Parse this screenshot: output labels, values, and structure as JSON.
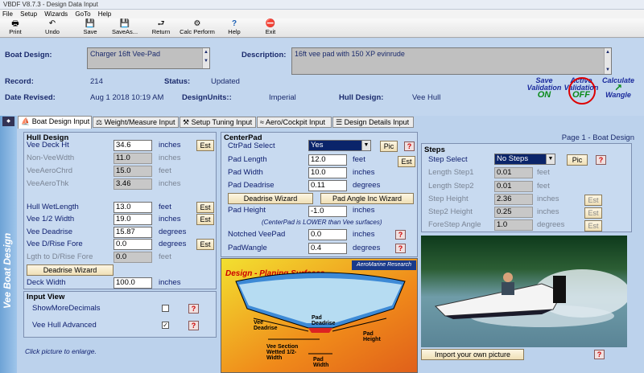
{
  "window_title": "VBDF V8.7.3 - Design Data Input",
  "menu": [
    "File",
    "Setup",
    "Wizards",
    "GoTo",
    "Help"
  ],
  "toolbar": [
    {
      "label": "Print",
      "icon": "🖶"
    },
    {
      "label": "Undo",
      "icon": "↶"
    },
    {
      "label": "Save",
      "icon": "💾"
    },
    {
      "label": "SaveAs...",
      "icon": "💾"
    },
    {
      "label": "Return",
      "icon": "⮐"
    },
    {
      "label": "Calc Perform",
      "icon": "⚙"
    },
    {
      "label": "Help",
      "icon": "?"
    },
    {
      "label": "Exit",
      "icon": "⛔"
    }
  ],
  "header": {
    "boat_design_label": "Boat Design:",
    "boat_design_value": "Charger 16ft Vee-Pad",
    "description_label": "Description:",
    "description_value": "16ft vee pad with 150 XP evinrude",
    "record_label": "Record:",
    "record_value": "214",
    "status_label": "Status:",
    "status_value": "Updated",
    "date_label": "Date Revised:",
    "date_value": "Aug 1 2018 10:19 AM",
    "units_label": "DesignUnits::",
    "units_value": "Imperial",
    "hull_label": "Hull Design:",
    "hull_value": "Vee Hull",
    "save_validation": [
      "Save",
      "Validation",
      "ON"
    ],
    "active_validation": [
      "Active",
      "Validation",
      "OFF"
    ],
    "calculate": [
      "Calculate",
      "Wangle"
    ]
  },
  "tabs": [
    "Boat Design Input",
    "Weight/Measure Input",
    "Setup Tuning Input",
    "Aero/Cockpit Input",
    "Design Details Input"
  ],
  "sidebar_title": "Vee Boat Design",
  "page_header": "Page 1 - Boat Design",
  "hull": {
    "title": "Hull Design",
    "est": "Est",
    "wizard": "Deadrise Wizard",
    "fields": [
      {
        "label": "Vee Deck Ht",
        "value": "34.6",
        "unit": "inches"
      },
      {
        "label": "Non-VeeWdth",
        "value": "11.0",
        "unit": "inches"
      },
      {
        "label": "VeeAeroChrd",
        "value": "15.0",
        "unit": "feet"
      },
      {
        "label": "VeeAeroThk",
        "value": "3.46",
        "unit": "inches"
      },
      {
        "label": "Hull WetLength",
        "value": "13.0",
        "unit": "feet"
      },
      {
        "label": "Vee 1/2 Width",
        "value": "19.0",
        "unit": "inches"
      },
      {
        "label": "Vee Deadrise",
        "value": "15.87",
        "unit": "degrees"
      },
      {
        "label": "Vee D/Rise Fore",
        "value": "0.0",
        "unit": "degrees"
      },
      {
        "label": "Lgth to D/Rise Fore",
        "value": "0.0",
        "unit": "feet"
      },
      {
        "label": "Deck Width",
        "value": "100.0",
        "unit": "inches"
      }
    ]
  },
  "input_view": {
    "title": "Input View",
    "show_more": "ShowMoreDecimals",
    "vee_advanced": "Vee Hull Advanced",
    "check_mark": "✓"
  },
  "click_note": "Click picture to enlarge.",
  "centerpad": {
    "title": "CenterPad",
    "select_label": "CtrPad Select",
    "select_value": "Yes",
    "pic": "Pic",
    "est": "Est",
    "deadrise_wizard": "Deadrise Wizard",
    "angle_wizard": "Pad Angle Inc Wizard",
    "note": "(CenterPad is LOWER than Vee surfaces)",
    "fields": [
      {
        "label": "Pad Length",
        "value": "12.0",
        "unit": "feet"
      },
      {
        "label": "Pad Width",
        "value": "10.0",
        "unit": "inches"
      },
      {
        "label": "Pad Deadrise",
        "value": "0.11",
        "unit": "degrees"
      },
      {
        "label": "Pad Height",
        "value": "-1.0",
        "unit": "inches"
      },
      {
        "label": "Notched VeePad",
        "value": "0.0",
        "unit": "inches"
      },
      {
        "label": "PadWangle",
        "value": "0.4",
        "unit": "degrees"
      }
    ]
  },
  "diagram": {
    "title": "Design - Planing Surfaces",
    "logo": "AeroMarine Research",
    "labels": [
      "Pad Deadrise",
      "Vee Deadrise",
      "Pad Height",
      "Vee Section Wetted 1/2-Width",
      "Pad Width"
    ]
  },
  "steps": {
    "title": "Steps",
    "select_label": "Step Select",
    "select_value": "No Steps",
    "pic": "Pic",
    "est": "Est",
    "fields": [
      {
        "label": "Length Step1",
        "value": "0.01",
        "unit": "feet"
      },
      {
        "label": "Length Step2",
        "value": "0.01",
        "unit": "feet"
      },
      {
        "label": "Step Height",
        "value": "2.36",
        "unit": "inches"
      },
      {
        "label": "Step2 Height",
        "value": "0.25",
        "unit": "inches"
      },
      {
        "label": "ForeStep Angle",
        "value": "1.0",
        "unit": "degrees"
      }
    ]
  },
  "import_picture": "Import your own picture",
  "help_mark": "?",
  "colors": {
    "navy": "#1a2a6c",
    "panel": "#c8daf0",
    "red": "#cc0000"
  }
}
